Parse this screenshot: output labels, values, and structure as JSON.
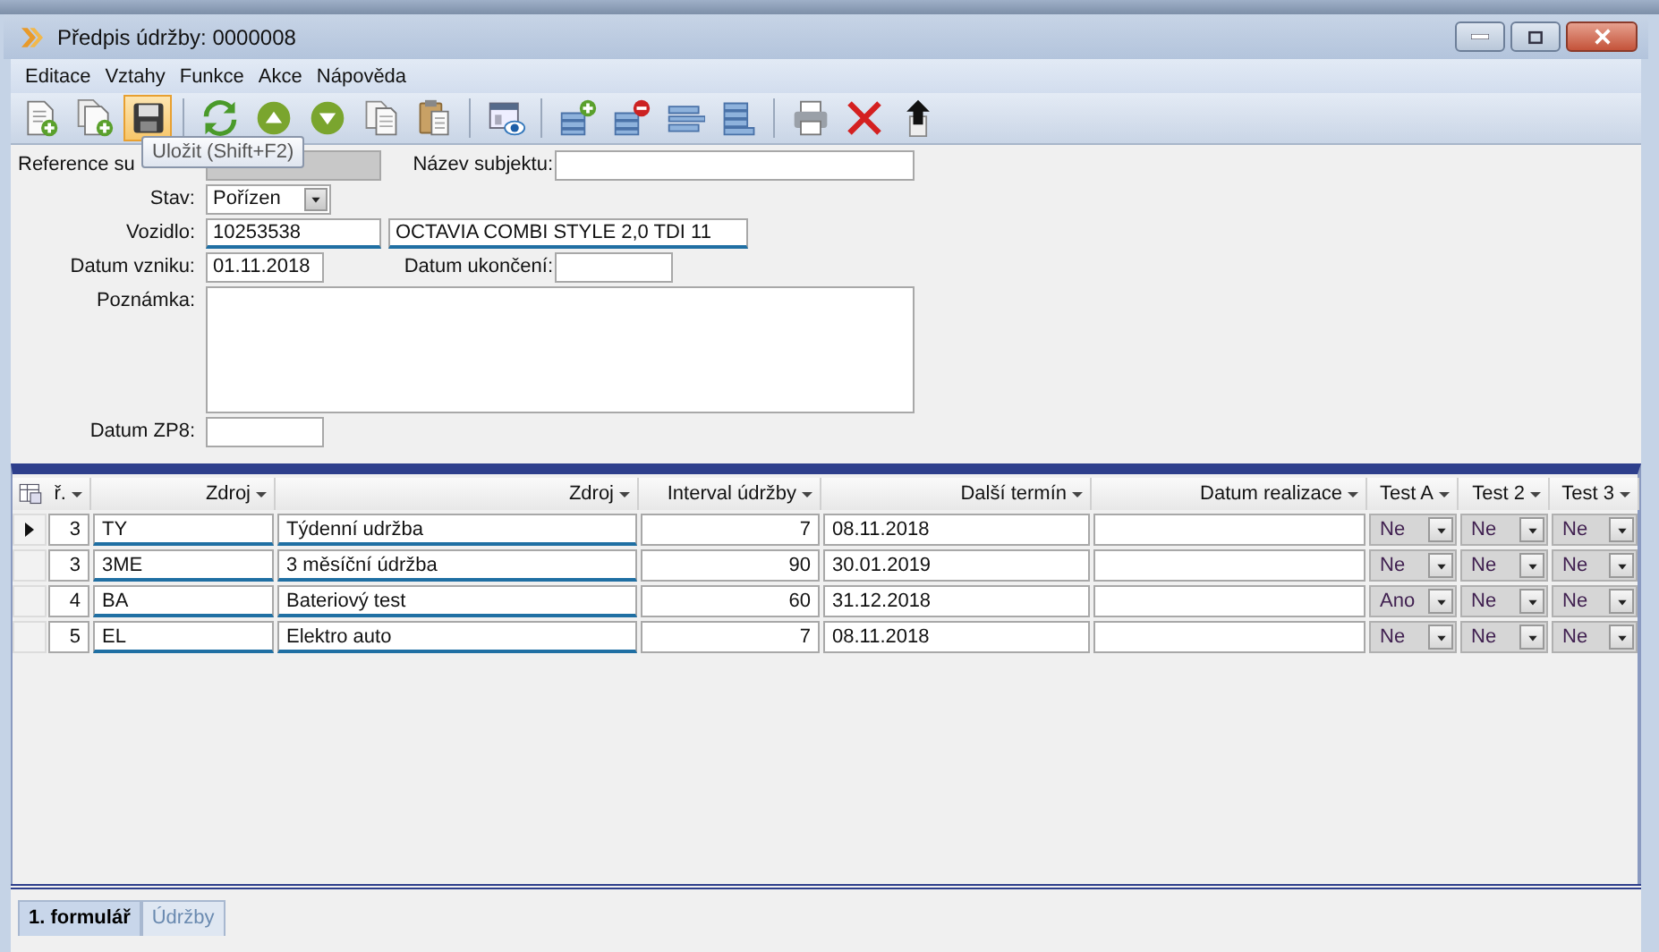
{
  "window": {
    "title": "Předpis údržby: 0000008"
  },
  "menu": [
    "Editace",
    "Vztahy",
    "Funkce",
    "Akce",
    "Nápověda"
  ],
  "toolbar": {
    "buttons": [
      {
        "kind": "new",
        "hovered": false
      },
      {
        "kind": "copy_new",
        "hovered": false
      },
      {
        "kind": "save",
        "hovered": true
      },
      {
        "kind": "separator"
      },
      {
        "kind": "refresh",
        "hovered": false
      },
      {
        "kind": "up",
        "hovered": false
      },
      {
        "kind": "down",
        "hovered": false
      },
      {
        "kind": "copy",
        "hovered": false
      },
      {
        "kind": "paste",
        "hovered": false
      },
      {
        "kind": "separator"
      },
      {
        "kind": "view",
        "hovered": false
      },
      {
        "kind": "separator"
      },
      {
        "kind": "add_row",
        "hovered": false
      },
      {
        "kind": "remove_row",
        "hovered": false
      },
      {
        "kind": "split_rows",
        "hovered": false
      },
      {
        "kind": "rows",
        "hovered": false
      },
      {
        "kind": "separator"
      },
      {
        "kind": "print",
        "hovered": false
      },
      {
        "kind": "delete",
        "hovered": false
      },
      {
        "kind": "upload",
        "hovered": false
      }
    ]
  },
  "tooltip": {
    "text": "Uložit (Shift+F2)"
  },
  "form": {
    "rows": [
      {
        "fields": [
          {
            "label": "Reference su",
            "kind": "code",
            "disabled": true,
            "lookup": false
          },
          {
            "label": "Název subjektu:",
            "kind": "name",
            "disabled": false,
            "lookup": false
          }
        ]
      },
      {
        "fields": [
          {
            "label": "Stav:",
            "kind": "combo",
            "value": "Pořízen",
            "disabled": false,
            "lookup": false
          }
        ]
      },
      {
        "fields": [
          {
            "label": "Vozidlo:",
            "kind": "code",
            "value": "10253538",
            "disabled": false,
            "lookup": true
          },
          {
            "kind": "name",
            "value": "OCTAVIA COMBI STYLE 2,0 TDI 11",
            "disabled": false,
            "lookup": true
          }
        ]
      },
      {
        "fields": [
          {
            "label": "Datum vzniku:",
            "kind": "date",
            "value": "01.11.2018",
            "disabled": false,
            "lookup": false
          },
          {
            "label": "Datum ukončení:",
            "kind": "date",
            "disabled": false,
            "lookup": false
          }
        ]
      },
      {
        "fields": [
          {
            "label": "Poznámka:",
            "kind": "memo",
            "disabled": false,
            "lookup": false
          }
        ]
      },
      {
        "fields": [
          {
            "label": "Datum ZP8:",
            "kind": "date",
            "disabled": false,
            "lookup": false
          }
        ]
      }
    ]
  },
  "grid": {
    "columns": [
      "ř.",
      "Zdroj",
      "Zdroj",
      "Interval údržby",
      "Další termín",
      "Datum realizace",
      "Test A",
      "Test 2",
      "Test 3"
    ],
    "rows": [
      {
        "current": true,
        "number": "3",
        "code": "TY",
        "name": "Týdenní udržba",
        "interval": "7",
        "next_date": "08.11.2018",
        "tests": [
          "Ne",
          "Ne",
          "Ne"
        ]
      },
      {
        "current": false,
        "number": "3",
        "code": "3ME",
        "name": "3 měsíční údržba",
        "interval": "90",
        "next_date": "30.01.2019",
        "tests": [
          "Ne",
          "Ne",
          "Ne"
        ]
      },
      {
        "current": false,
        "number": "4",
        "code": "BA",
        "name": "Bateriový test",
        "interval": "60",
        "next_date": "31.12.2018",
        "tests": [
          "Ano",
          "Ne",
          "Ne"
        ]
      },
      {
        "current": false,
        "number": "5",
        "code": "EL",
        "name": "Elektro auto",
        "interval": "7",
        "next_date": "08.11.2018",
        "tests": [
          "Ne",
          "Ne",
          "Ne"
        ]
      }
    ]
  },
  "tabs": [
    {
      "label": "1. formulář",
      "selected": true
    },
    {
      "label": "Údržby",
      "selected": false
    }
  ]
}
